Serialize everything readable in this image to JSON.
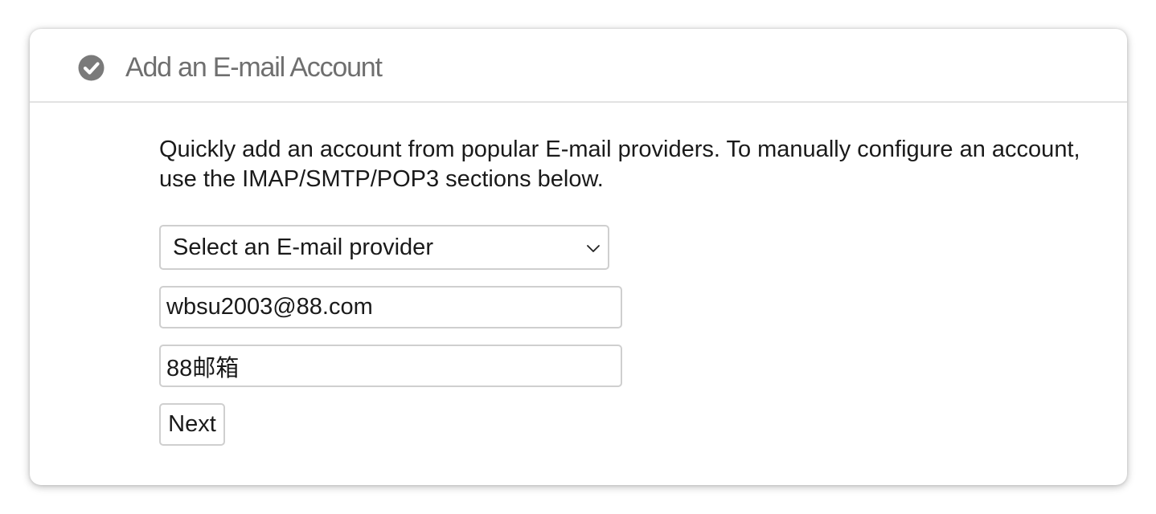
{
  "panel": {
    "title": "Add an E-mail Account",
    "title_icon": "check-circle-icon",
    "description": "Quickly add an account from popular E-mail providers. To manually configure an account, use the IMAP/SMTP/POP3 sections below."
  },
  "form": {
    "provider_select": {
      "selected": "Select an E-mail provider"
    },
    "email_field": {
      "value": "wbsu2003@88.com"
    },
    "account_name_field": {
      "value": "88邮箱"
    },
    "next_label": "Next"
  },
  "colors": {
    "title": "#6f6f6f",
    "icon": "#7a7a7a",
    "border": "#cfcfcf",
    "divider": "#e2e2e2"
  }
}
